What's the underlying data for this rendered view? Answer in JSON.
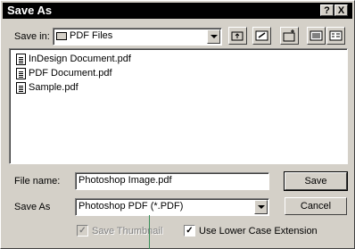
{
  "window": {
    "title": "Save As",
    "help_button": "?",
    "close_button": "X"
  },
  "toolbar": {
    "save_in_label": "Save in:",
    "save_in_value": "PDF Files"
  },
  "files": [
    {
      "name": "InDesign Document.pdf"
    },
    {
      "name": "PDF Document.pdf"
    },
    {
      "name": "Sample.pdf"
    }
  ],
  "form": {
    "file_name_label": "File name:",
    "file_name_value": "Photoshop Image.pdf",
    "save_as_label": "Save As",
    "save_as_value": "Photoshop PDF (*.PDF)",
    "save_button": "Save",
    "cancel_button": "Cancel",
    "save_thumbnail_label": "Save Thumbnail",
    "save_thumbnail_checked": true,
    "lower_case_label": "Use Lower Case Extension",
    "lower_case_checked": true
  }
}
